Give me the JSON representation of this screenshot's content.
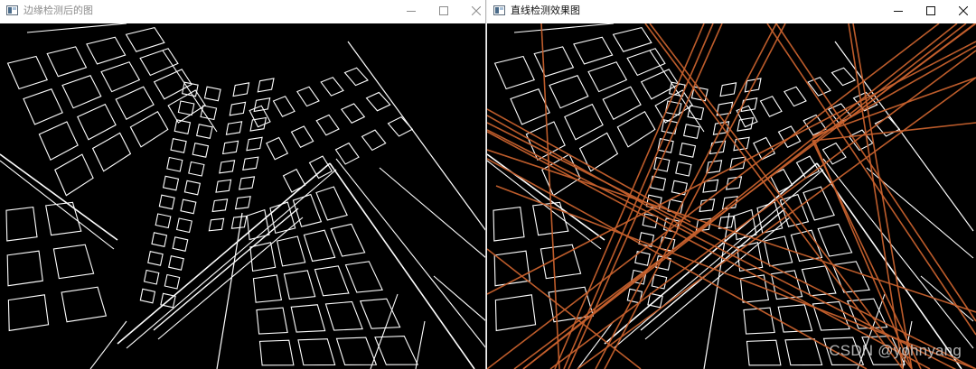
{
  "windows": {
    "left": {
      "title": "边缘检测后的图",
      "icon": "app-window-icon",
      "active": false
    },
    "right": {
      "title": "直线检测效果图",
      "icon": "app-window-icon",
      "active": true
    }
  },
  "controls": [
    "minimize-icon",
    "maximize-icon",
    "close-icon"
  ],
  "watermark": "CSDN @yohnyang",
  "colors": {
    "edge_lines": "#ffffff",
    "detected_lines": "#c8612e",
    "canvas_background": "#000000",
    "titlebar_background": "#ffffff",
    "inactive_title_text": "#8c8c8c",
    "active_title_text": "#111111"
  }
}
